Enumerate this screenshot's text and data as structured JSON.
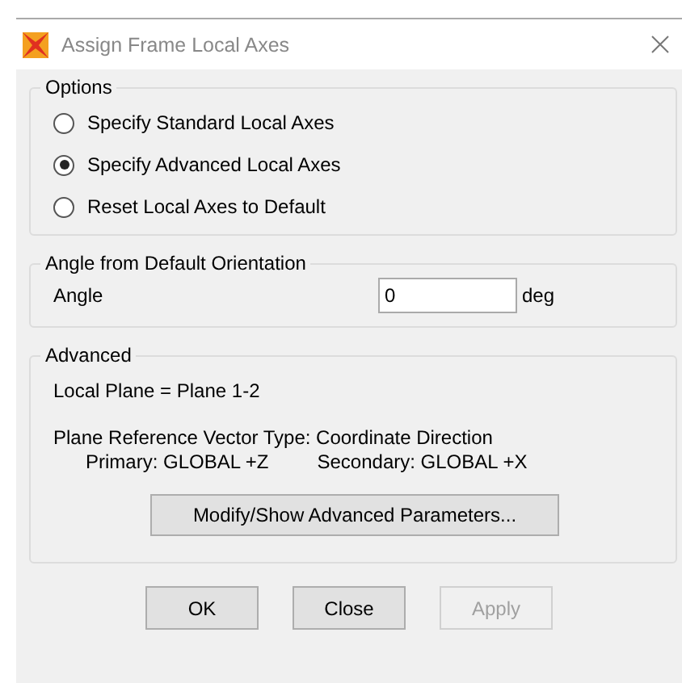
{
  "window": {
    "title": "Assign Frame Local Axes"
  },
  "options": {
    "title": "Options",
    "items": [
      {
        "label": "Specify Standard Local Axes",
        "selected": false
      },
      {
        "label": "Specify Advanced Local Axes",
        "selected": true
      },
      {
        "label": "Reset Local Axes to Default",
        "selected": false
      }
    ]
  },
  "angle": {
    "title": "Angle from Default Orientation",
    "label": "Angle",
    "value": "0",
    "unit": "deg"
  },
  "advanced": {
    "title": "Advanced",
    "local_plane": "Local Plane = Plane 1-2",
    "vector_type": "Plane Reference Vector Type:  Coordinate Direction",
    "primary": "Primary:  GLOBAL +Z",
    "secondary": "Secondary:  GLOBAL +X",
    "button": "Modify/Show Advanced Parameters..."
  },
  "buttons": [
    {
      "label": "OK",
      "disabled": false
    },
    {
      "label": "Close",
      "disabled": false
    },
    {
      "label": "Apply",
      "disabled": true
    }
  ]
}
